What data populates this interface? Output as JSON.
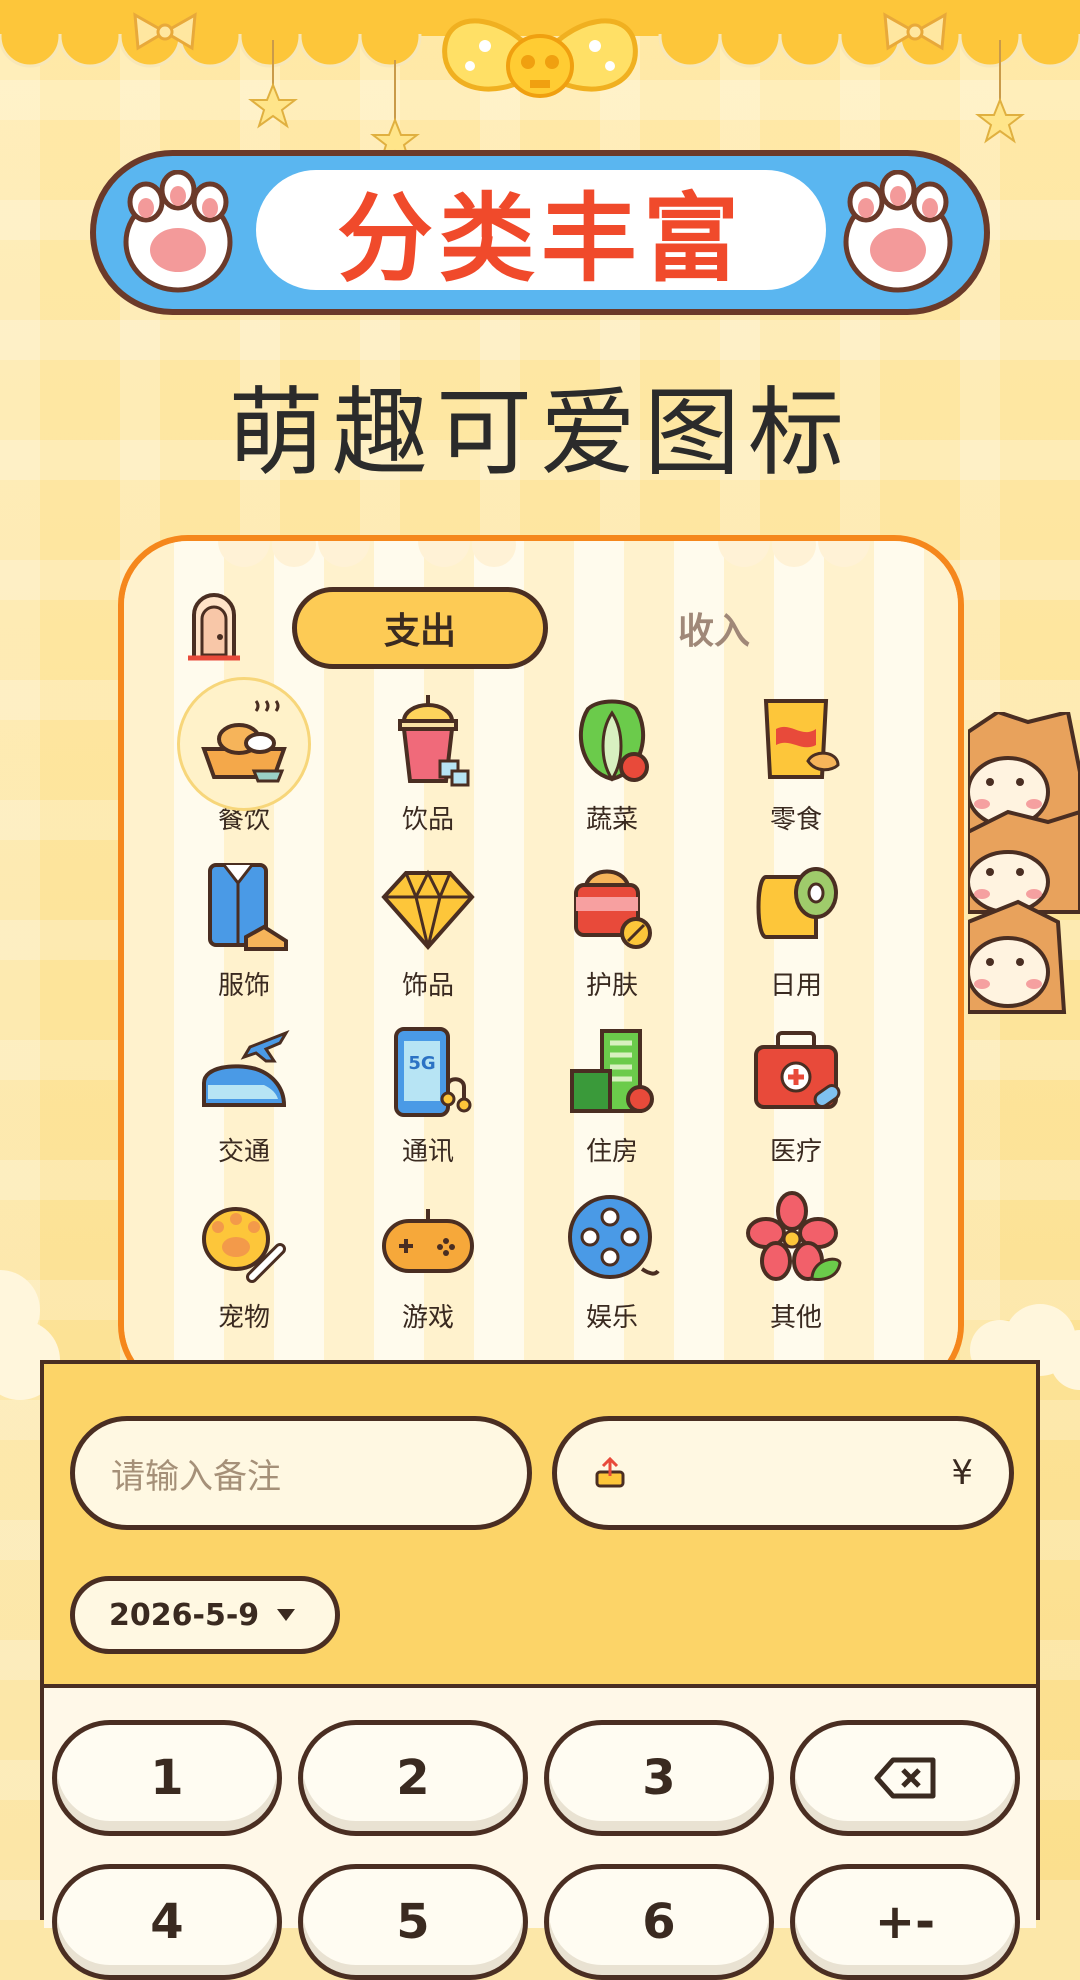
{
  "header": {
    "banner_title": "分类丰富",
    "subtitle": "萌趣可爱图标"
  },
  "tabs": {
    "expense": "支出",
    "income": "收入",
    "selected": "支出"
  },
  "categories": [
    {
      "label": "餐饮",
      "icon": "meal-icon",
      "selected": true
    },
    {
      "label": "饮品",
      "icon": "drink-icon"
    },
    {
      "label": "蔬菜",
      "icon": "vegetable-icon"
    },
    {
      "label": "零食",
      "icon": "snack-icon"
    },
    {
      "label": "服饰",
      "icon": "clothing-icon"
    },
    {
      "label": "饰品",
      "icon": "diamond-icon"
    },
    {
      "label": "护肤",
      "icon": "skincare-icon"
    },
    {
      "label": "日用",
      "icon": "tissue-roll-icon"
    },
    {
      "label": "交通",
      "icon": "train-plane-icon"
    },
    {
      "label": "通讯",
      "icon": "phone-5g-icon"
    },
    {
      "label": "住房",
      "icon": "building-icon"
    },
    {
      "label": "医疗",
      "icon": "medical-kit-icon"
    },
    {
      "label": "宠物",
      "icon": "paw-bone-icon"
    },
    {
      "label": "游戏",
      "icon": "gamepad-icon"
    },
    {
      "label": "娱乐",
      "icon": "film-reel-icon"
    },
    {
      "label": "其他",
      "icon": "flower-icon"
    }
  ],
  "form": {
    "note_placeholder": "请输入备注",
    "currency_symbol": "¥",
    "date": "2026-5-9"
  },
  "keypad": {
    "row1": [
      "1",
      "2",
      "3"
    ],
    "row2": [
      "4",
      "5",
      "6"
    ],
    "backspace_icon": "backspace-icon",
    "plus_minus": "+-"
  },
  "colors": {
    "accent_yellow": "#FDCB55",
    "banner_blue": "#5AB6F0",
    "banner_red_text": "#F04A2B",
    "card_border_orange": "#F5871C",
    "outline_brown": "#4A2E22"
  }
}
